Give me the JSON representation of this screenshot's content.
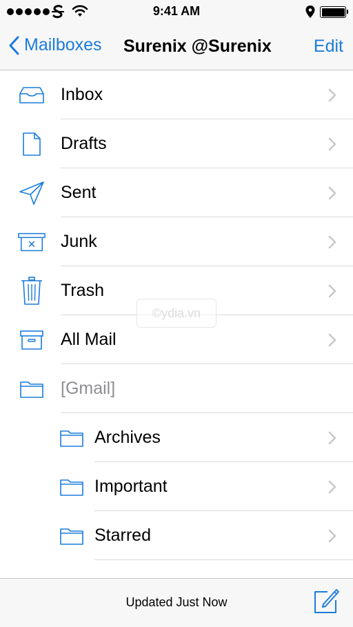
{
  "status_bar": {
    "time": "9:41 AM",
    "signal_dots": 5,
    "icons": [
      "signal-dots-icon",
      "carrier-icon",
      "wifi-icon",
      "location-icon",
      "battery-icon"
    ]
  },
  "nav": {
    "back_label": "Mailboxes",
    "title": "Surenix @Surenix",
    "edit_label": "Edit"
  },
  "mailboxes": [
    {
      "label": "Inbox",
      "icon": "inbox-icon"
    },
    {
      "label": "Drafts",
      "icon": "document-icon"
    },
    {
      "label": "Sent",
      "icon": "paper-plane-icon"
    },
    {
      "label": "Junk",
      "icon": "junk-bin-icon"
    },
    {
      "label": "Trash",
      "icon": "trash-icon"
    },
    {
      "label": "All Mail",
      "icon": "archive-box-icon"
    },
    {
      "label": "[Gmail]",
      "icon": "folder-icon"
    },
    {
      "label": "Archives",
      "icon": "folder-icon"
    },
    {
      "label": "Important",
      "icon": "folder-icon"
    },
    {
      "label": "Starred",
      "icon": "folder-icon"
    }
  ],
  "watermark": "©ydia.vn",
  "toolbar": {
    "status": "Updated Just Now",
    "compose_icon": "compose-icon"
  },
  "colors": {
    "accent": "#1a7bdc",
    "bar_background": "#f7f7f7",
    "separator": "#d9d9dc",
    "muted_text": "#8e8e93"
  }
}
